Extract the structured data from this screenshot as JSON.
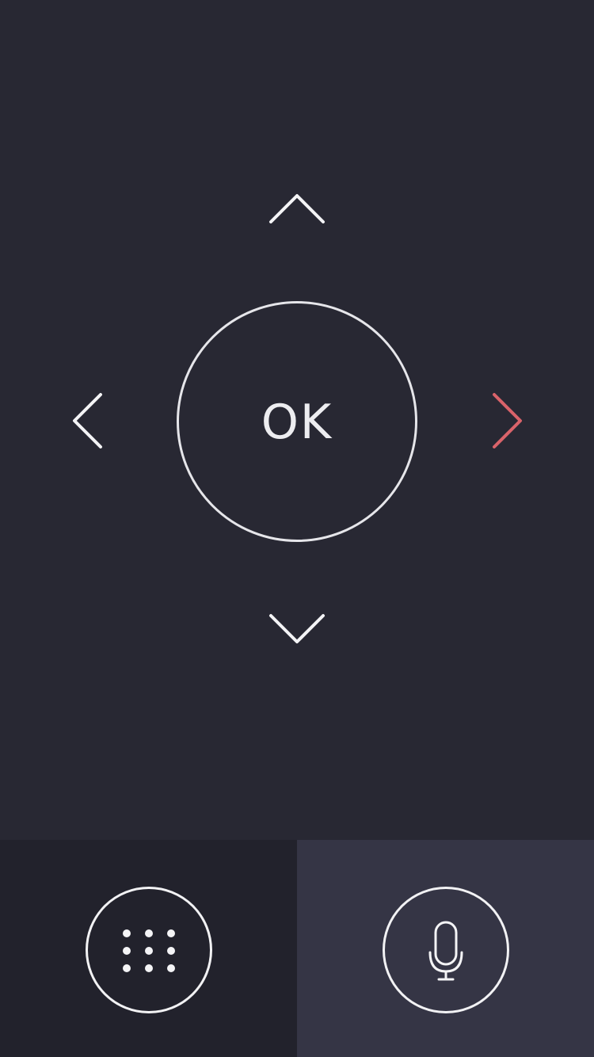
{
  "dpad": {
    "ok_label": "OK",
    "icons": {
      "up": "chevron-up-icon",
      "down": "chevron-down-icon",
      "left": "chevron-left-icon",
      "right": "chevron-right-icon"
    }
  },
  "bottom_bar": {
    "left_button_icon": "keypad-icon",
    "right_button_icon": "microphone-icon"
  },
  "colors": {
    "background": "#282833",
    "bottom_left_panel": "#22222c",
    "bottom_right_panel": "#353545",
    "foreground": "#f2f2f4",
    "accent_active_arrow": "#d9636a"
  }
}
